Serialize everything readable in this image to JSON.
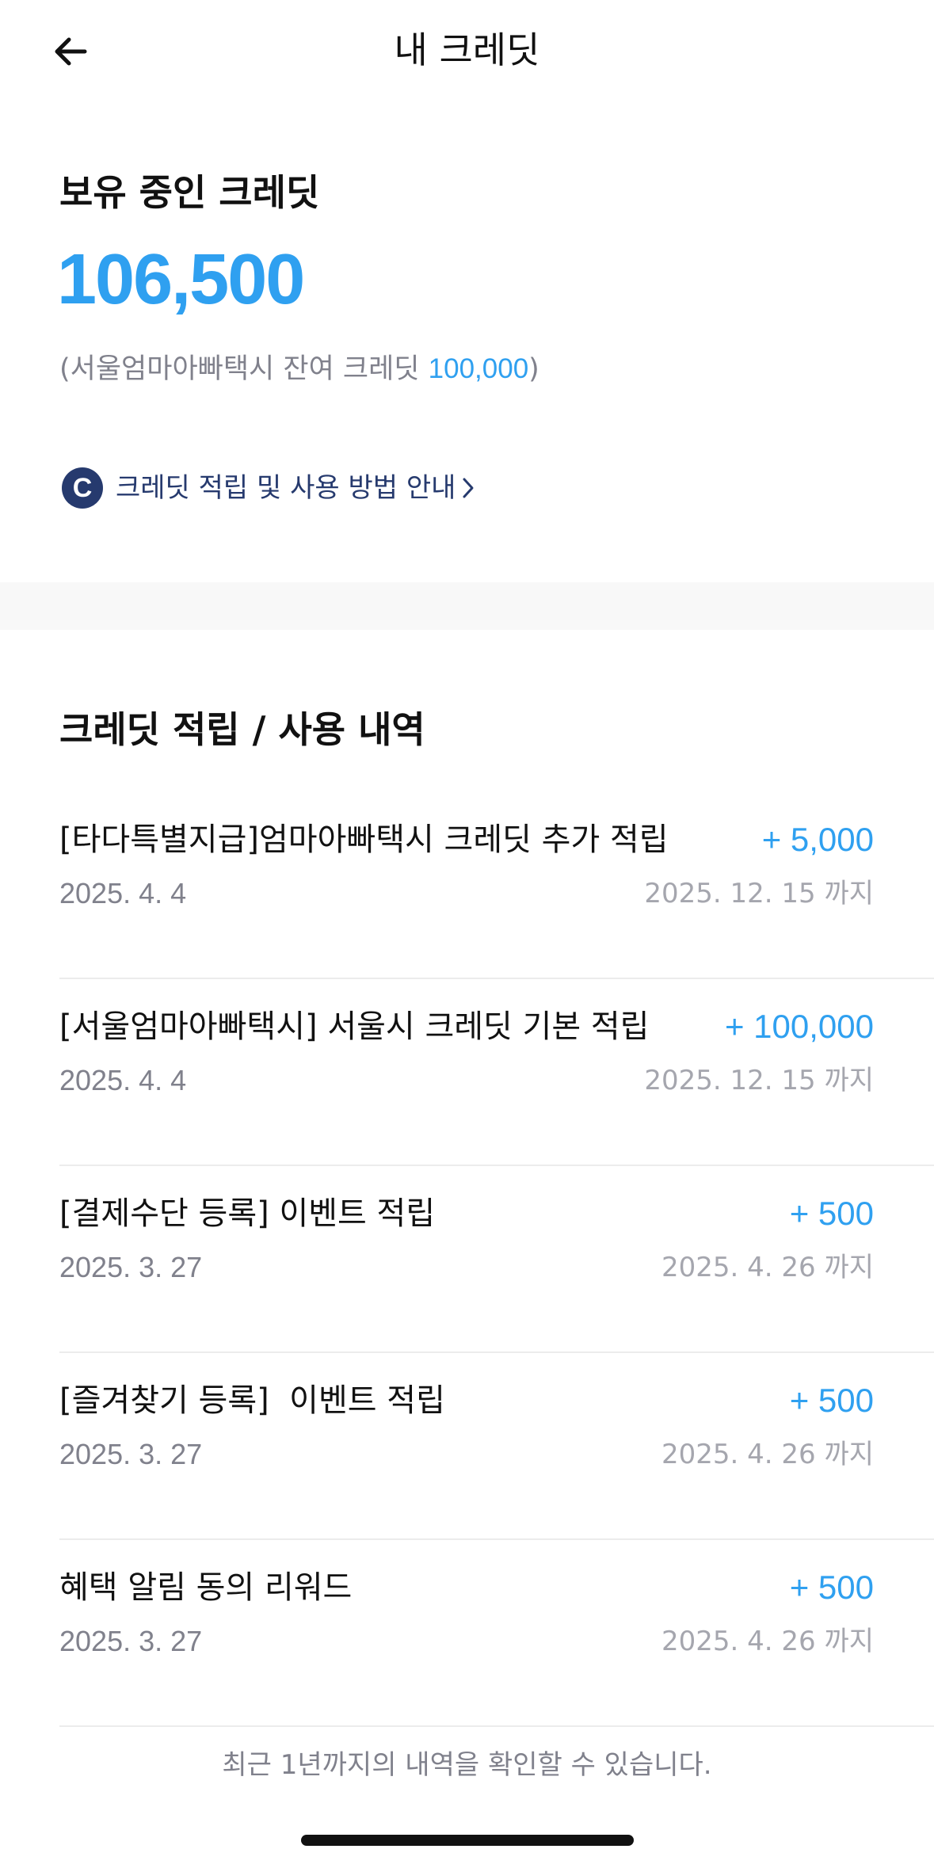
{
  "header": {
    "back_icon": "arrow-left-icon",
    "title": "내 크레딧"
  },
  "balance": {
    "heading": "보유 중인 크레딧",
    "amount": "106,500",
    "sub_prefix": "(서울엄마아빠택시 잔여 크레딧 ",
    "sub_value": "100,000",
    "sub_suffix": ")"
  },
  "guide": {
    "icon": "credit-c-icon",
    "icon_letter": "C",
    "label": "크레딧 적립 및 사용 방법 안내",
    "chevron_icon": "chevron-right-icon"
  },
  "history": {
    "heading": "크레딧 적립 / 사용 내역",
    "items": [
      {
        "title": "[타다특별지급]엄마아빠택시 크레딧 추가 적립",
        "amount": "+ 5,000",
        "date": "2025. 4. 4",
        "expiry": "2025. 12. 15 까지"
      },
      {
        "title": "[서울엄마아빠택시] 서울시 크레딧 기본 적립",
        "amount": "+ 100,000",
        "date": "2025. 4. 4",
        "expiry": "2025. 12. 15 까지"
      },
      {
        "title": "[결제수단 등록] 이벤트 적립",
        "amount": "+ 500",
        "date": "2025. 3. 27",
        "expiry": "2025. 4. 26 까지"
      },
      {
        "title": "[즐겨찾기 등록]  이벤트 적립",
        "amount": "+ 500",
        "date": "2025. 3. 27",
        "expiry": "2025. 4. 26 까지"
      },
      {
        "title": "혜택 알림 동의 리워드",
        "amount": "+ 500",
        "date": "2025. 3. 27",
        "expiry": "2025. 4. 26 까지"
      }
    ]
  },
  "footer": {
    "note": "최근 1년까지의 내역을 확인할 수 있습니다."
  },
  "colors": {
    "accent": "#2fa0f0",
    "navy": "#263a6e",
    "muted": "#80818c"
  }
}
